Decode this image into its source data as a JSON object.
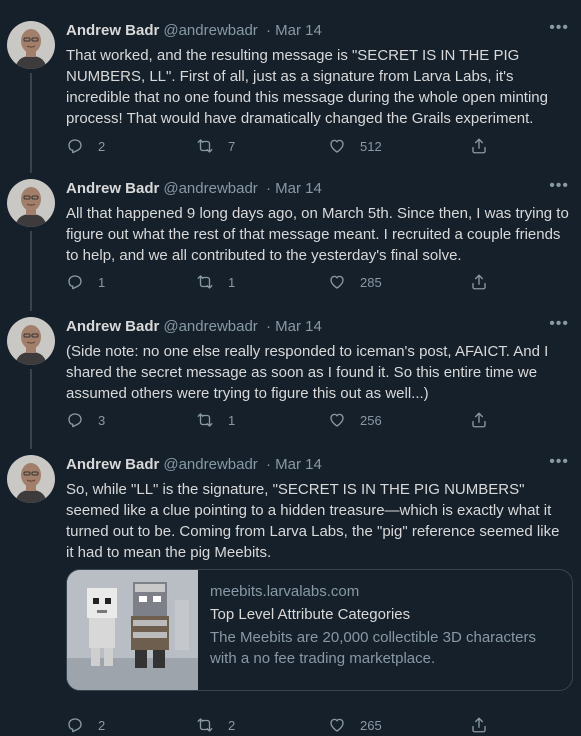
{
  "tweets": [
    {
      "name": "Andrew Badr",
      "handle": "@andrewbadr",
      "date": "· Mar 14",
      "text": "That worked, and the resulting message is \"SECRET IS IN THE PIG NUMBERS, LL\". First of all, just as a signature from Larva Labs, it's incredible that no one found this message during the whole open minting process! That would have dramatically changed the Grails experiment.",
      "replies": "2",
      "retweets": "7",
      "likes": "512"
    },
    {
      "name": "Andrew Badr",
      "handle": "@andrewbadr",
      "date": "· Mar 14",
      "text": "All that happened 9 long days ago, on March 5th. Since then, I was trying to figure out what the rest of that message meant. I recruited a couple friends to help, and we all contributed to the yesterday's final solve.",
      "replies": "1",
      "retweets": "1",
      "likes": "285"
    },
    {
      "name": "Andrew Badr",
      "handle": "@andrewbadr",
      "date": "· Mar 14",
      "text": "(Side note: no one else really responded to iceman's post, AFAICT. And I shared the secret message as soon as I found it. So this entire time we assumed others were trying to figure this out as well...)",
      "replies": "3",
      "retweets": "1",
      "likes": "256"
    },
    {
      "name": "Andrew Badr",
      "handle": "@andrewbadr",
      "date": "· Mar 14",
      "text": "So, while \"LL\" is the signature, \"SECRET IS IN THE PIG NUMBERS\" seemed like a clue pointing to a hidden treasure—which is exactly what it turned out to be. Coming from Larva Labs, the \"pig\" reference seemed like it had to mean the pig Meebits.",
      "replies": "2",
      "retweets": "2",
      "likes": "265"
    }
  ],
  "card": {
    "domain": "meebits.larvalabs.com",
    "title": "Top Level Attribute Categories",
    "description": "The Meebits are 20,000 collectible 3D characters with a no fee trading marketplace."
  },
  "icons": {
    "reply": "reply-icon",
    "retweet": "retweet-icon",
    "like": "heart-icon",
    "share": "share-icon",
    "more": "more-icon"
  },
  "colors": {
    "background": "#15202b",
    "text": "#d9d9d9",
    "secondary": "#8899a6",
    "border": "#38444d"
  }
}
